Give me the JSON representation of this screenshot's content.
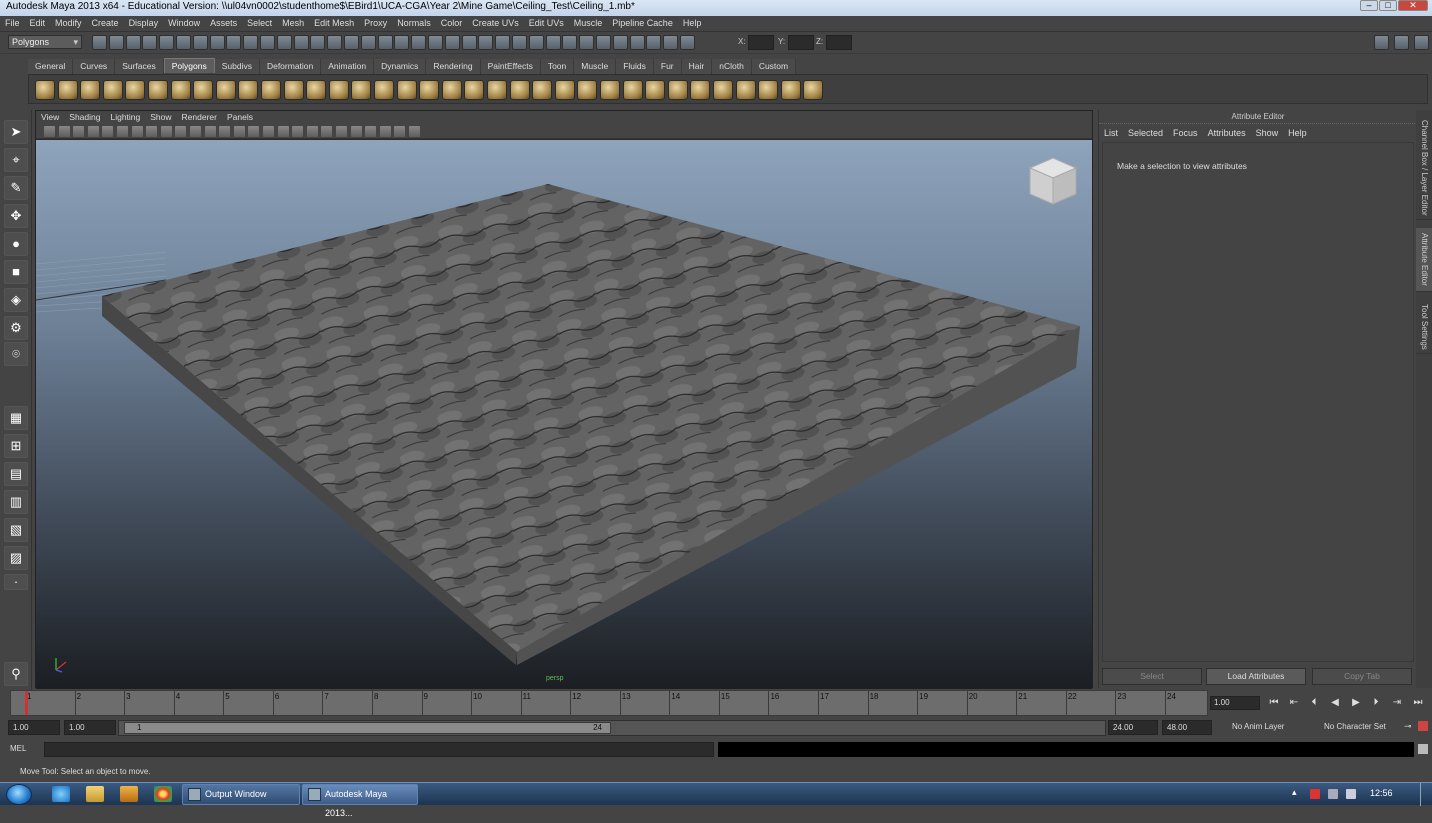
{
  "window": {
    "title": "Autodesk Maya 2013 x64 - Educational Version: \\\\ul04vn0002\\studenthome$\\EBird1\\UCA-CGA\\Year 2\\Mine Game\\Ceiling_Test\\Ceiling_1.mb*"
  },
  "menubar": [
    "File",
    "Edit",
    "Modify",
    "Create",
    "Display",
    "Window",
    "Assets",
    "Select",
    "Mesh",
    "Edit Mesh",
    "Proxy",
    "Normals",
    "Color",
    "Create UVs",
    "Edit UVs",
    "Muscle",
    "Pipeline Cache",
    "Help"
  ],
  "statusline": {
    "menu_set": "Polygons",
    "coord_x": "X:",
    "coord_y": "Y:",
    "coord_z": "Z:"
  },
  "shelf": {
    "tabs": [
      "General",
      "Curves",
      "Surfaces",
      "Polygons",
      "Subdivs",
      "Deformation",
      "Animation",
      "Dynamics",
      "Rendering",
      "PaintEffects",
      "Toon",
      "Muscle",
      "Fluids",
      "Fur",
      "Hair",
      "nCloth",
      "Custom"
    ],
    "active_tab": "Polygons",
    "icon_count": 35
  },
  "viewport": {
    "menu": [
      "View",
      "Shading",
      "Lighting",
      "Show",
      "Renderer",
      "Panels"
    ],
    "camera_label": "persp",
    "viewcube_faces": [
      "TOP",
      "FRONT",
      "RIGHT"
    ]
  },
  "attribute_editor": {
    "title": "Attribute Editor",
    "menu": [
      "List",
      "Selected",
      "Focus",
      "Attributes",
      "Show",
      "Help"
    ],
    "message": "Make a selection to view attributes",
    "buttons": {
      "select": "Select",
      "load": "Load Attributes",
      "copy_tab": "Copy Tab"
    }
  },
  "side_tabs": [
    "Channel Box / Layer Editor",
    "Attribute Editor",
    "Tool Settings"
  ],
  "timeline": {
    "frames": [
      "1",
      "2",
      "3",
      "4",
      "5",
      "6",
      "7",
      "8",
      "9",
      "10",
      "11",
      "12",
      "13",
      "14",
      "15",
      "16",
      "17",
      "18",
      "19",
      "20",
      "21",
      "22",
      "23",
      "24"
    ],
    "current_frame": "1.00"
  },
  "range": {
    "start": "1.00",
    "playback_start": "1.00",
    "knob_start": "1",
    "knob_end": "24",
    "playback_end": "24.00",
    "end": "48.00",
    "anim_layer": "No Anim Layer",
    "character_set": "No Character Set"
  },
  "command_line": {
    "label": "MEL"
  },
  "help_line": {
    "text": "Move Tool: Select an object to move."
  },
  "taskbar": {
    "buttons": [
      "Output Window",
      "Autodesk Maya 2013..."
    ],
    "clock": "12:56"
  },
  "colors": {
    "accent": "#5d5d5d",
    "panel": "#444444",
    "sky_top": "#8ea4bc",
    "sky_bottom": "#1b1e22",
    "slab_top": "#6a6a6a",
    "slab_side": "#4c4c4c"
  }
}
